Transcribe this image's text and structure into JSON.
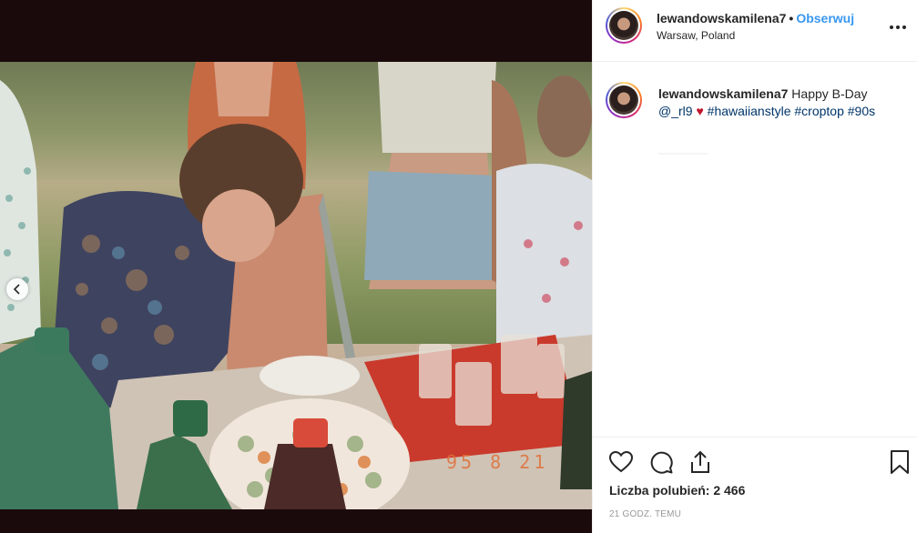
{
  "post": {
    "username": "lewandowskamilena7",
    "separator": "•",
    "follow_label": "Obserwuj",
    "location": "Warsaw, Poland",
    "photo_date_stamp": "95 8 21"
  },
  "caption": {
    "username": "lewandowskamilena7",
    "text_before": "Happy B-Day",
    "mention": "@_rl9",
    "heart": "♥",
    "hashtags": [
      "#hawaiianstyle",
      "#croptop",
      "#90s"
    ]
  },
  "icons": {
    "more": "more-options-icon",
    "like": "heart-icon",
    "comment": "comment-icon",
    "share": "share-icon",
    "save": "bookmark-icon",
    "prev": "chevron-left-icon"
  },
  "likes_label": "Liczba polubień: 2 466",
  "timestamp": "21 GODZ. TEMU",
  "colors": {
    "link": "#3897f0",
    "hashtag": "#003569",
    "heart": "#c0152b",
    "text": "#262626",
    "muted": "#999999"
  }
}
